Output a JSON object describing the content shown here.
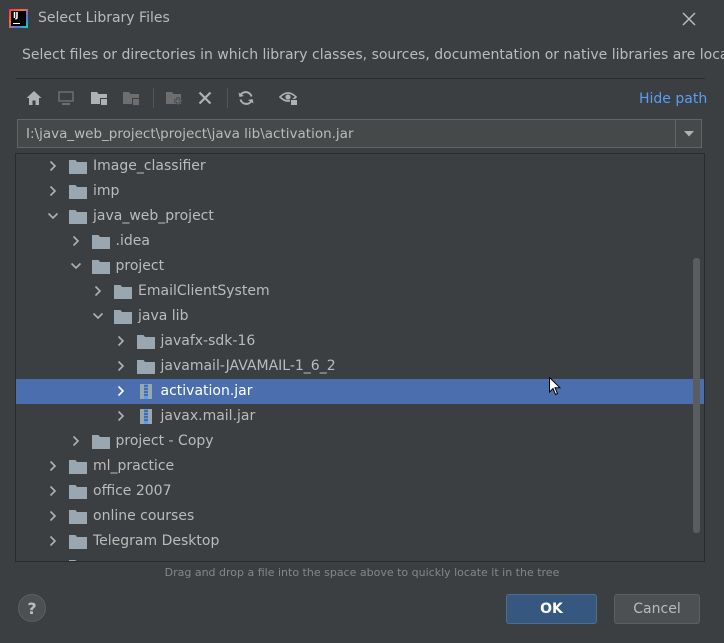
{
  "window": {
    "title": "Select Library Files",
    "app_icon": "intellij-idea-icon"
  },
  "description": "Select files or directories in which library classes, sources, documentation or native libraries are located",
  "toolbar": {
    "buttons": [
      "home-icon",
      "desktop-icon",
      "project-folder-icon",
      "module-folder-icon",
      "new-folder-icon",
      "delete-icon",
      "refresh-icon",
      "show-hidden-icon"
    ],
    "hide_path_label": "Hide path"
  },
  "path": {
    "value": "I:\\java_web_project\\project\\java lib\\activation.jar"
  },
  "tree": {
    "rows": [
      {
        "label": "Image_classifier",
        "type": "folder",
        "expanded": false
      },
      {
        "label": "imp",
        "type": "folder",
        "expanded": false
      },
      {
        "label": "java_web_project",
        "type": "folder",
        "expanded": true
      },
      {
        "label": ".idea",
        "type": "folder",
        "expanded": false
      },
      {
        "label": "project",
        "type": "folder",
        "expanded": true
      },
      {
        "label": "EmailClientSystem",
        "type": "folder",
        "expanded": false
      },
      {
        "label": "java lib",
        "type": "folder",
        "expanded": true
      },
      {
        "label": "javafx-sdk-16",
        "type": "folder",
        "expanded": false
      },
      {
        "label": "javamail-JAVAMAIL-1_6_2",
        "type": "folder",
        "expanded": false
      },
      {
        "label": "activation.jar",
        "type": "jar",
        "expanded": false,
        "selected": true
      },
      {
        "label": "javax.mail.jar",
        "type": "jar",
        "expanded": false
      },
      {
        "label": "project - Copy",
        "type": "folder",
        "expanded": false
      },
      {
        "label": "ml_practice",
        "type": "folder",
        "expanded": false
      },
      {
        "label": "office 2007",
        "type": "folder",
        "expanded": false
      },
      {
        "label": "online courses",
        "type": "folder",
        "expanded": false
      },
      {
        "label": "Telegram Desktop",
        "type": "folder",
        "expanded": false
      }
    ]
  },
  "hint": "Drag and drop a file into the space above to quickly locate it in the tree",
  "buttons": {
    "help": "?",
    "ok": "OK",
    "cancel": "Cancel"
  },
  "colors": {
    "background": "#3c3f41",
    "selection": "#4b6eaf",
    "link": "#589df6",
    "folder": "#9aa7b0",
    "ok_button": "#365880"
  }
}
